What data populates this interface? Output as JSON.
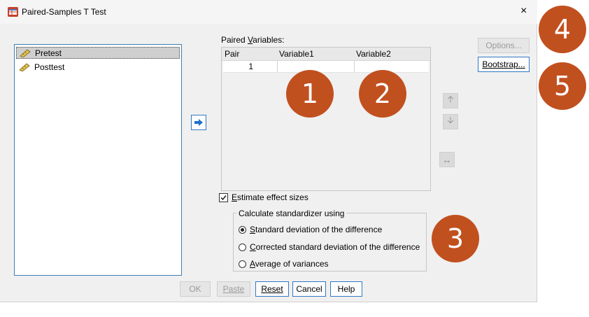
{
  "window": {
    "title": "Paired-Samples T Test",
    "close_glyph": "×"
  },
  "source_list": {
    "items": [
      {
        "label": "Pretest",
        "selected": true,
        "icon": "scale-ruler-icon"
      },
      {
        "label": "Posttest",
        "selected": false,
        "icon": "scale-ruler-icon"
      }
    ]
  },
  "paired_variables": {
    "label_prefix": "Paired ",
    "label_underlined": "V",
    "label_suffix": "ariables:",
    "columns": [
      "Pair",
      "Variable1",
      "Variable2"
    ],
    "rows": [
      {
        "pair": "1",
        "variable1": "",
        "variable2": ""
      }
    ]
  },
  "side_buttons": {
    "options": "Options...",
    "bootstrap": "Bootstrap..."
  },
  "effect_sizes": {
    "checked": true,
    "label_underlined": "E",
    "label_rest": "stimate effect sizes"
  },
  "standardizer": {
    "group_title": "Calculate standardizer using",
    "options": [
      {
        "underlined": "S",
        "rest": "tandard deviation of the difference",
        "selected": true
      },
      {
        "underlined": "C",
        "rest": "orrected standard deviation of the difference",
        "selected": false
      },
      {
        "underlined": "A",
        "rest": "verage of variances",
        "selected": false
      }
    ]
  },
  "footer_buttons": {
    "ok": "OK",
    "paste": "Paste",
    "reset": "Reset",
    "cancel": "Cancel",
    "help": "Help"
  },
  "annotations": {
    "badge_1": "1",
    "badge_2": "2",
    "badge_3": "3",
    "badge_4": "4",
    "badge_5": "5"
  },
  "colors": {
    "badge": "#c1501f",
    "accent_border": "#3178c6"
  }
}
